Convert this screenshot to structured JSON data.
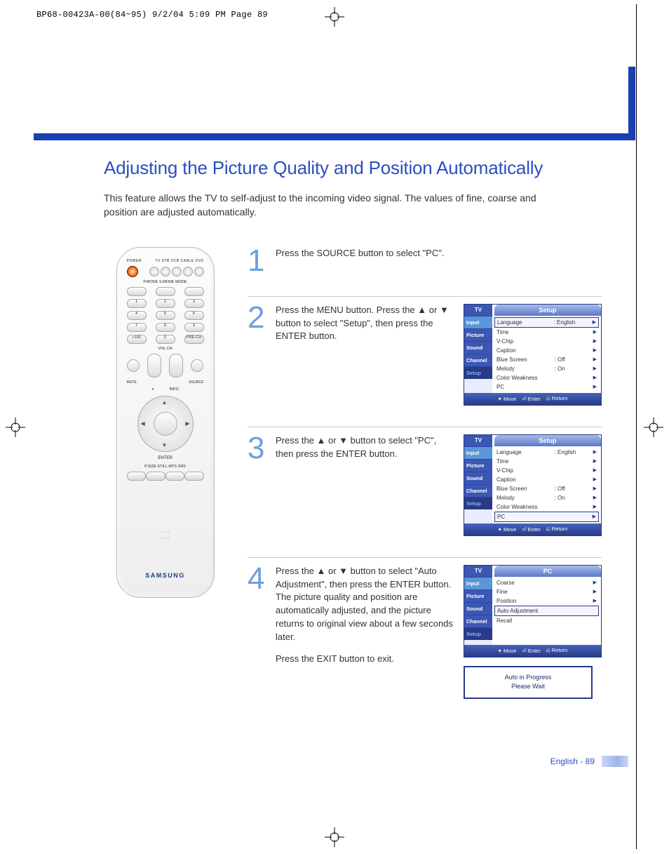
{
  "print_header": "BP68-00423A-00(84~95)  9/2/04  5:09 PM  Page 89",
  "title": "Adjusting the Picture Quality and Position Automatically",
  "intro": "This feature allows the TV to self-adjust to the incoming video signal. The values of fine, coarse and position are adjusted automatically.",
  "remote": {
    "power_label": "POWER",
    "device_row": "TV   STB   VCR   CABLE   DVD",
    "mode_labels": "P.MODE    S.MODE    MODE",
    "bottom_labels": "VOL            CH",
    "mute": "MUTE",
    "source": "SOURCE",
    "enter": "ENTER",
    "info": "INFO",
    "row4_labels": "P.SIZE   STILL    MTS    SRS",
    "brand": "SAMSUNG",
    "precH": "PRE-CH",
    "plus100": "+100"
  },
  "steps": [
    {
      "num": "1",
      "text": "Press the SOURCE button to select \"PC\"."
    },
    {
      "num": "2",
      "text": "Press the MENU button. Press the ▲ or ▼ button to select \"Setup\", then press the ENTER button.",
      "osd": {
        "tv": "TV",
        "title": "Setup",
        "tabs": [
          "Input",
          "Picture",
          "Sound",
          "Channel",
          "Setup"
        ],
        "rows": [
          {
            "label": "Language",
            "value": ": English",
            "hl": true
          },
          {
            "label": "Time",
            "value": ""
          },
          {
            "label": "V-Chip",
            "value": ""
          },
          {
            "label": "Caption",
            "value": ""
          },
          {
            "label": "Blue Screen",
            "value": ": Off"
          },
          {
            "label": "Melody",
            "value": ": On"
          },
          {
            "label": "Color Weakness",
            "value": ""
          },
          {
            "label": "PC",
            "value": ""
          }
        ],
        "foot": [
          "Move",
          "Enter",
          "Return"
        ]
      }
    },
    {
      "num": "3",
      "text": "Press the ▲ or ▼ button to select \"PC\", then press the ENTER button.",
      "osd": {
        "tv": "TV",
        "title": "Setup",
        "tabs": [
          "Input",
          "Picture",
          "Sound",
          "Channel",
          "Setup"
        ],
        "rows": [
          {
            "label": "Language",
            "value": ": English"
          },
          {
            "label": "Time",
            "value": ""
          },
          {
            "label": "V-Chip",
            "value": ""
          },
          {
            "label": "Caption",
            "value": ""
          },
          {
            "label": "Blue Screen",
            "value": ": Off"
          },
          {
            "label": "Melody",
            "value": ": On"
          },
          {
            "label": "Color Weakness",
            "value": ""
          },
          {
            "label": "PC",
            "value": "",
            "hl": true
          }
        ],
        "foot": [
          "Move",
          "Enter",
          "Return"
        ]
      }
    },
    {
      "num": "4",
      "text": "Press the ▲ or ▼ button to select \"Auto Adjustment\", then press the ENTER button. The picture quality and position are automatically adjusted, and the picture returns to original view about a few seconds later.",
      "after": "Press the EXIT button to exit.",
      "osd": {
        "tv": "TV",
        "title": "PC",
        "tabs": [
          "Input",
          "Picture",
          "Sound",
          "Channel",
          "Setup"
        ],
        "rows": [
          {
            "label": "Coarse",
            "value": ""
          },
          {
            "label": "Fine",
            "value": ""
          },
          {
            "label": "Position",
            "value": ""
          },
          {
            "label": "Auto Adjustment",
            "value": "",
            "hl": true
          },
          {
            "label": "Recall",
            "value": ""
          }
        ],
        "foot": [
          "Move",
          "Enter",
          "Return"
        ]
      },
      "wait": {
        "l1": "Auto in Progress",
        "l2": "Please Wait"
      }
    }
  ],
  "footer": {
    "lang": "English",
    "page": "89"
  },
  "osd_prefix": {
    "move": "✦ ",
    "enter": "⏎ ",
    "return": "⎌ "
  }
}
